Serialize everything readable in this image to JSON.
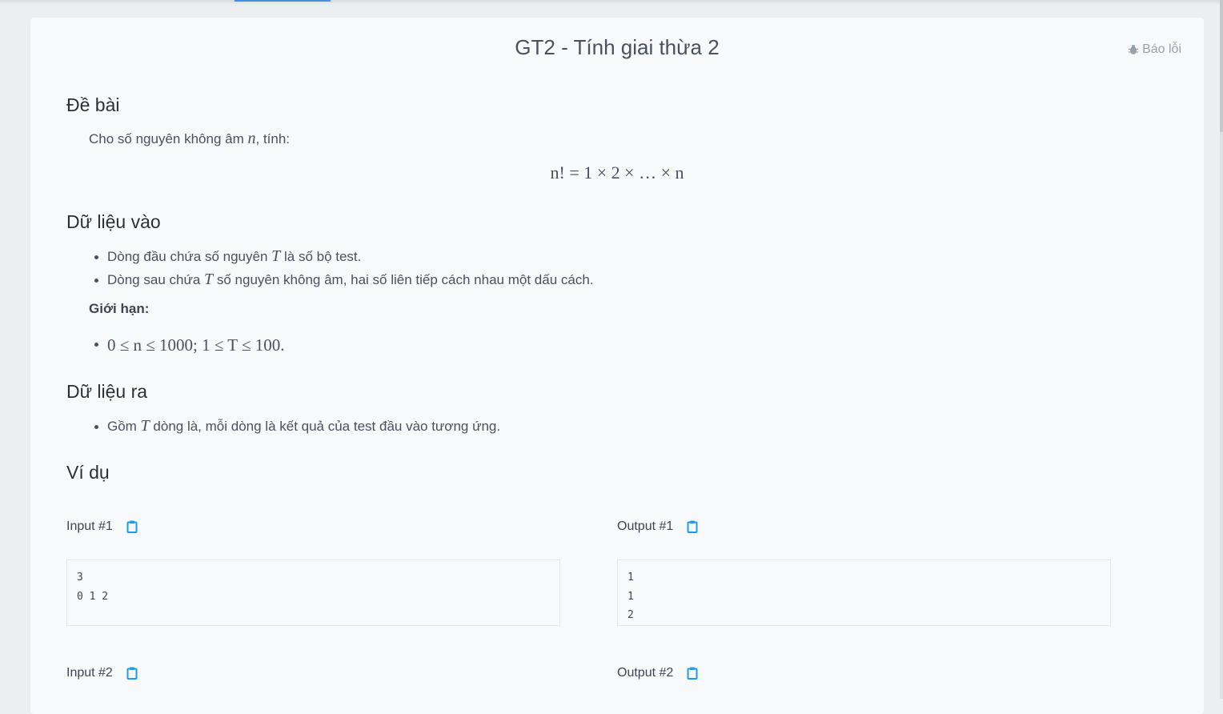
{
  "problem": {
    "title": "GT2 - Tính giai thừa 2",
    "report_label": "Báo lỗi"
  },
  "statement": {
    "heading": "Đề bài",
    "intro_before": "Cho số nguyên không âm ",
    "intro_var": "n",
    "intro_after": ", tính:",
    "formula": "n! = 1 × 2 × … × n"
  },
  "input_section": {
    "heading": "Dữ liệu vào",
    "items": [
      {
        "before": "Dòng đầu chứa số nguyên ",
        "var": "T",
        "after": " là số bộ test."
      },
      {
        "before": "Dòng sau chứa ",
        "var": "T",
        "after": " số nguyên không âm, hai số liên tiếp cách nhau một dấu cách."
      }
    ],
    "limits_label": "Giới hạn:",
    "limits": "0 ≤ n ≤ 1000; 1 ≤ T ≤ 100."
  },
  "output_section": {
    "heading": "Dữ liệu ra",
    "items": [
      {
        "before": "Gồm ",
        "var": "T",
        "after": " dòng là, mỗi dòng là kết quả của test đầu vào tương ứng."
      }
    ]
  },
  "examples": {
    "heading": "Ví dụ",
    "pairs": [
      {
        "input_label": "Input #1",
        "output_label": "Output #1",
        "input_lines": [
          "3",
          "0 1 2"
        ],
        "output_lines": [
          "1",
          "1",
          "2"
        ]
      },
      {
        "input_label": "Input #2",
        "output_label": "Output #2"
      }
    ]
  },
  "colors": {
    "accent": "#1e9be9",
    "card_bg": "#f8f9fa",
    "page_bg": "#eceef0"
  }
}
